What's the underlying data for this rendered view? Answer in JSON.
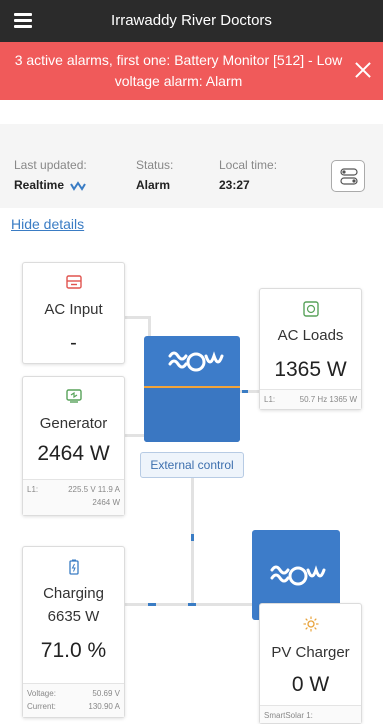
{
  "header": {
    "title": "Irrawaddy River Doctors"
  },
  "alarm": {
    "message": "3 active alarms, first one: Battery Monitor [512] - Low voltage alarm: Alarm"
  },
  "status": {
    "last_updated_label": "Last updated:",
    "last_updated_value": "Realtime",
    "status_label": "Status:",
    "status_value": "Alarm",
    "local_time_label": "Local time:",
    "local_time_value": "23:27"
  },
  "hide_details": "Hide details",
  "ac_input": {
    "title": "AC Input",
    "value": "-"
  },
  "generator": {
    "title": "Generator",
    "value": "2464 W",
    "foot_label": "L1:",
    "foot_values": "225.5 V  11.9 A",
    "foot_power": "2464 W"
  },
  "ac_loads": {
    "title": "AC Loads",
    "value": "1365 W",
    "foot_label": "L1:",
    "foot_values": "50.7 Hz  1365 W"
  },
  "external_control": "External control",
  "battery": {
    "title": "Charging",
    "power": "6635 W",
    "soc": "71.0 %",
    "voltage_label": "Voltage:",
    "voltage_value": "50.69 V",
    "current_label": "Current:",
    "current_value": "130.90 A"
  },
  "pv_charger": {
    "title": "PV Charger",
    "value": "0 W",
    "foot_label": "SmartSolar 1:"
  },
  "colors": {
    "alarm": "#f05a5a",
    "victron_blue": "#3d7cc9",
    "link": "#3a7cc4",
    "topbar": "#2b2b2b"
  }
}
